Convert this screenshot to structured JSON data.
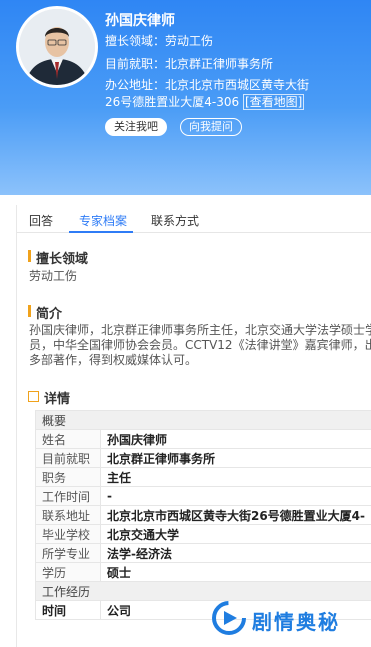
{
  "profile": {
    "name": "孙国庆律师",
    "field_label": "擅长领域：",
    "field_value": "劳动工伤",
    "firm_label": "目前就职：",
    "firm_value": "北京群正律师事务所",
    "addr_label": "办公地址：",
    "addr_value": "北京北京市西城区黄寺大街26号德胜置业大厦4-306",
    "map_link": "[查看地图]",
    "follow_button": "关注我吧",
    "ask_button": "向我提问"
  },
  "tabs": [
    "回答",
    "专家档案",
    "联系方式"
  ],
  "sections": {
    "field_title": "擅长领域",
    "field_text": "劳动工伤",
    "intro_title": "简介",
    "intro_lines": [
      "孙国庆律师，北京群正律师事务所主任，北京交通大学法学硕士学",
      "员，中华全国律师协会会员。CCTV12《法律讲堂》嘉宾律师，出",
      "多部著作，得到权威媒体认可。"
    ],
    "detail_title": "详情"
  },
  "details": {
    "overview_label": "概要",
    "rows": [
      {
        "k": "姓名",
        "v": "孙国庆律师"
      },
      {
        "k": "目前就职",
        "v": "北京群正律师事务所"
      },
      {
        "k": "职务",
        "v": "主任"
      },
      {
        "k": "工作时间",
        "v": "-"
      },
      {
        "k": "联系地址",
        "v": "北京北京市西城区黄寺大街26号德胜置业大厦4-"
      },
      {
        "k": "毕业学校",
        "v": "北京交通大学"
      },
      {
        "k": "所学专业",
        "v": "法学-经济法"
      },
      {
        "k": "学历",
        "v": "硕士"
      }
    ],
    "work_label": "工作经历",
    "work_col_time": "时间",
    "work_col_company": "公司"
  },
  "watermark": {
    "text": "剧情奥秘",
    "color": "#1f7de0"
  },
  "colors": {
    "accent": "#2f7cf6",
    "header": "#2f86f4",
    "section_marker": "#f0a21c"
  }
}
